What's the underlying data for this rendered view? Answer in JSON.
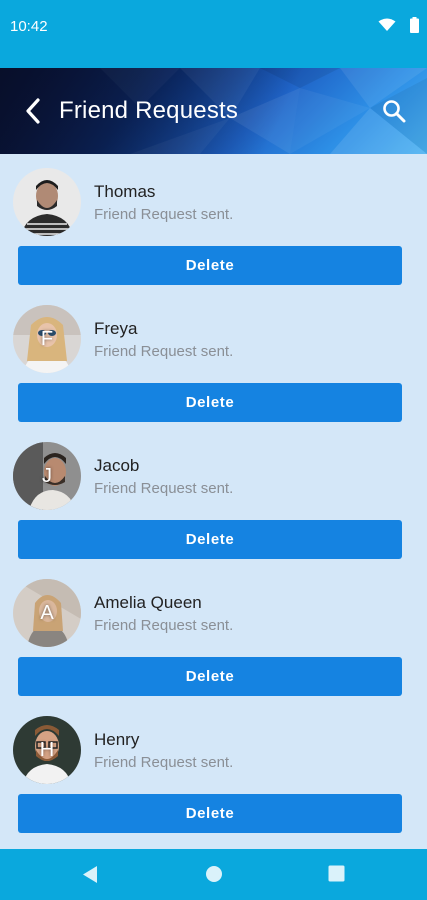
{
  "status_bar": {
    "time": "10:42"
  },
  "header": {
    "title": "Friend Requests"
  },
  "requests": [
    {
      "name": "Thomas",
      "status": "Friend Request sent.",
      "initial": "",
      "button": "Delete"
    },
    {
      "name": "Freya",
      "status": "Friend Request sent.",
      "initial": "F",
      "button": "Delete"
    },
    {
      "name": "Jacob",
      "status": "Friend Request sent.",
      "initial": "J",
      "button": "Delete"
    },
    {
      "name": "Amelia Queen",
      "status": "Friend Request sent.",
      "initial": "A",
      "button": "Delete"
    },
    {
      "name": "Henry",
      "status": "Friend Request sent.",
      "initial": "H",
      "button": "Delete"
    }
  ],
  "colors": {
    "status_bar": "#0aa8dd",
    "background": "#d4e7f8",
    "button": "#1583e1"
  },
  "icons": [
    "wifi-icon",
    "battery-icon",
    "back-arrow-icon",
    "search-icon",
    "nav-back-icon",
    "nav-home-icon",
    "nav-recents-icon"
  ]
}
